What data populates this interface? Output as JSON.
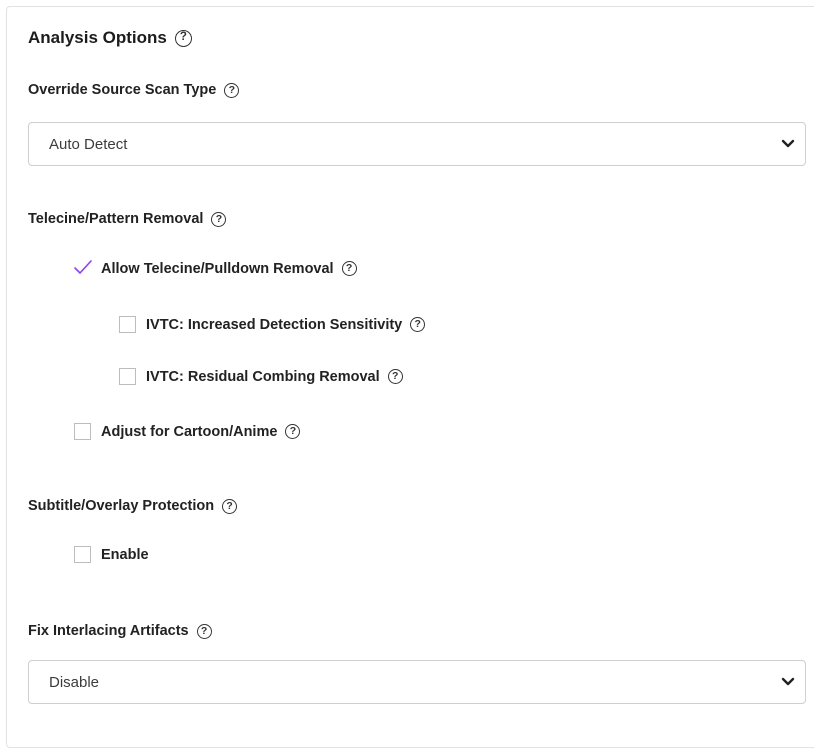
{
  "panel": {
    "title": "Analysis Options"
  },
  "scan_type": {
    "label": "Override Source Scan Type",
    "value": "Auto Detect"
  },
  "telecine": {
    "label": "Telecine/Pattern Removal",
    "options": [
      {
        "label": "Allow Telecine/Pulldown Removal",
        "checked": true
      },
      {
        "label": "IVTC: Increased Detection Sensitivity",
        "checked": false
      },
      {
        "label": "IVTC: Residual Combing Removal",
        "checked": false
      },
      {
        "label": "Adjust for Cartoon/Anime",
        "checked": false
      }
    ]
  },
  "subtitle": {
    "label": "Subtitle/Overlay Protection",
    "enable_label": "Enable",
    "enable_checked": false
  },
  "interlacing": {
    "label": "Fix Interlacing Artifacts",
    "value": "Disable"
  },
  "help_glyph": "?",
  "colors": {
    "check_accent": "#8a3ffc",
    "border": "#cfcfcf"
  }
}
